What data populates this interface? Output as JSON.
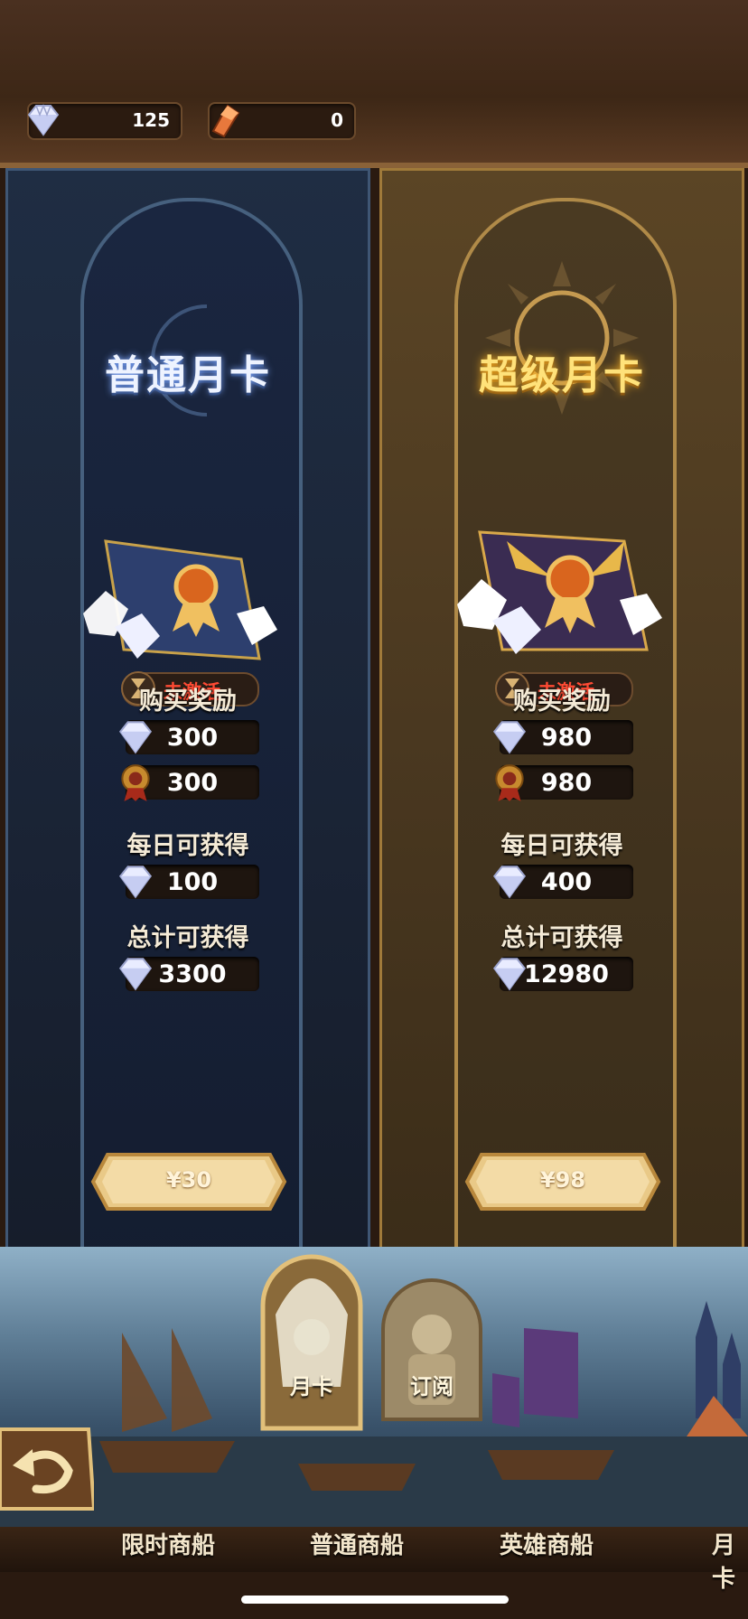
{
  "resources": {
    "diamonds": "125",
    "crystals": "0"
  },
  "cards": [
    {
      "title": "普通月卡",
      "status": "未激活",
      "purchase_label": "购买奖励",
      "purchase_diamonds": "300",
      "purchase_badge": "300",
      "daily_label": "每日可获得",
      "daily_diamonds": "100",
      "total_label": "总计可获得",
      "total_diamonds": "3300",
      "price": "¥30"
    },
    {
      "title": "超级月卡",
      "status": "未激活",
      "purchase_label": "购买奖励",
      "purchase_diamonds": "980",
      "purchase_badge": "980",
      "daily_label": "每日可获得",
      "daily_diamonds": "400",
      "total_label": "总计可获得",
      "total_diamonds": "12980",
      "price": "¥98"
    }
  ],
  "side_tabs": {
    "monthly": "月卡",
    "subscribe": "订阅"
  },
  "ship_tabs": [
    "限时商船",
    "普通商船",
    "英雄商船",
    "月卡"
  ],
  "icons": {
    "diamond": "diamond-icon",
    "crystal": "crystal-icon",
    "hourglass": "hourglass-icon",
    "badge": "medal-icon",
    "back": "back-arrow-icon"
  }
}
